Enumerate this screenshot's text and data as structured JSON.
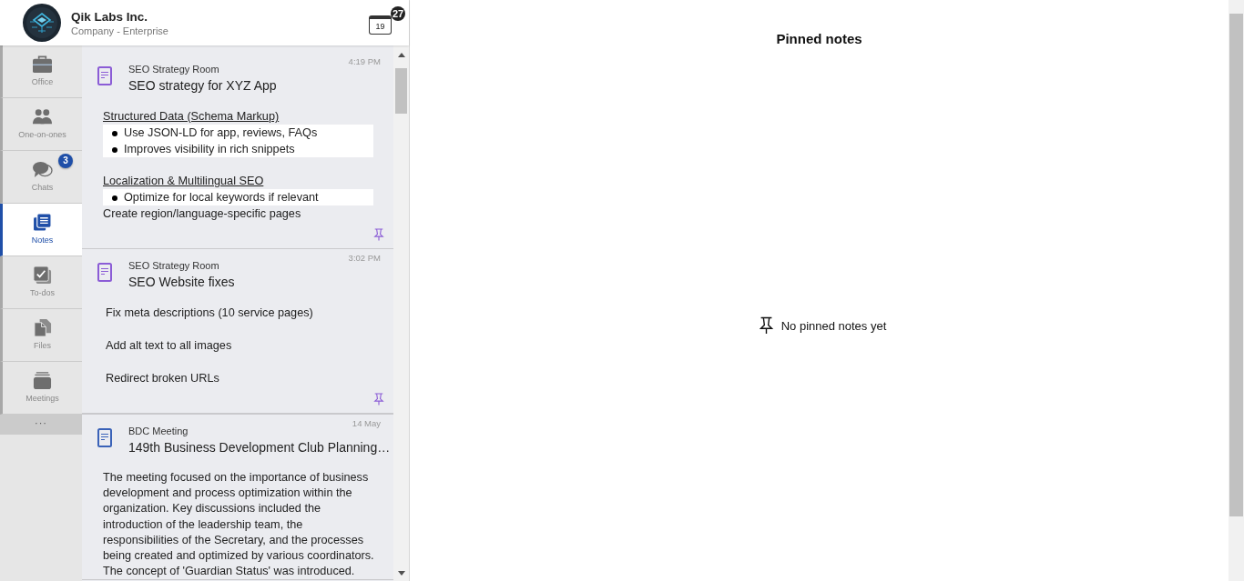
{
  "header": {
    "company_name": "Qik Labs Inc.",
    "company_type": "Company - Enterprise",
    "calendar_day": "19",
    "calendar_badge": "27"
  },
  "nav": {
    "items": [
      {
        "kind": "office",
        "label": "Office",
        "selected": false
      },
      {
        "kind": "people",
        "label": "One-on-ones",
        "selected": false
      },
      {
        "kind": "chats",
        "label": "Chats",
        "selected": false,
        "badge": "3"
      },
      {
        "kind": "notes",
        "label": "Notes",
        "selected": true
      },
      {
        "kind": "todos",
        "label": "To-dos",
        "selected": false
      },
      {
        "kind": "files",
        "label": "Files",
        "selected": false
      },
      {
        "kind": "meetings",
        "label": "Meetings",
        "selected": false
      }
    ],
    "more": "···"
  },
  "notes": [
    {
      "room": "SEO Strategy Room",
      "title": "SEO strategy for XYZ App",
      "time": "4:19 PM",
      "color": "#8b5cd6",
      "show_pin": true,
      "body": [
        {
          "kind": "heading",
          "text": "Structured Data (Schema Markup)"
        },
        {
          "kind": "bullets",
          "items": [
            "Use JSON-LD for app, reviews, FAQs",
            "Improves visibility in rich snippets"
          ]
        },
        {
          "kind": "heading",
          "text": "Localization & Multilingual SEO"
        },
        {
          "kind": "bullets",
          "items": [
            "Optimize for local keywords if relevant"
          ]
        },
        {
          "kind": "text",
          "text": "Create region/language-specific pages"
        }
      ]
    },
    {
      "room": "SEO Strategy Room",
      "title": "SEO Website fixes",
      "time": "3:02 PM",
      "color": "#8b5cd6",
      "show_pin": true,
      "body": [
        {
          "kind": "line",
          "text": "Fix meta descriptions (10 service pages)"
        },
        {
          "kind": "line",
          "text": "Add alt text to all images"
        },
        {
          "kind": "line",
          "text": "Redirect broken URLs"
        }
      ]
    },
    {
      "room": "BDC Meeting",
      "title": "149th Business Development Club Planning…",
      "time": "14 May",
      "color": "#3a62b8",
      "show_pin": false,
      "body": [
        {
          "kind": "paragraph",
          "text": "The meeting focused on the importance of business development and process optimization within the organization. Key discussions included the introduction of the leadership team, the responsibilities of the Secretary, and the processes being created and optimized by various coordinators. The concept of 'Guardian Status' was introduced."
        }
      ]
    }
  ],
  "pinned_panel": {
    "title": "Pinned notes",
    "empty_message": "No pinned notes yet"
  }
}
